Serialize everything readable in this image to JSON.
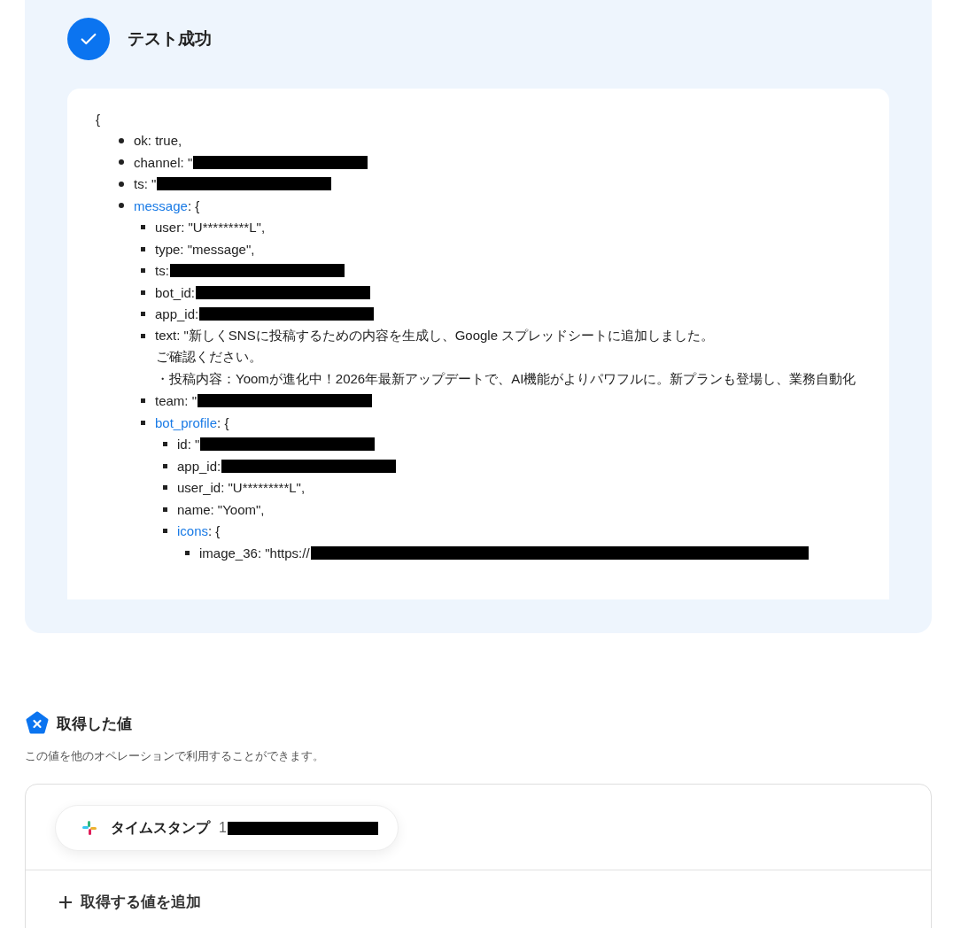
{
  "result": {
    "title": "テスト成功",
    "open_brace": "{",
    "items": [
      {
        "kind": "field",
        "text": "ok: true,"
      },
      {
        "kind": "redacted",
        "text": "channel: \""
      },
      {
        "kind": "redacted",
        "text": "ts: \""
      },
      {
        "kind": "object",
        "key": "message",
        "suffix": ": {",
        "children": [
          {
            "kind": "field",
            "text": "user: \"U*********L\","
          },
          {
            "kind": "field",
            "text": "type: \"message\","
          },
          {
            "kind": "redacted",
            "text": "ts: "
          },
          {
            "kind": "redacted",
            "text": "bot_id: "
          },
          {
            "kind": "redacted",
            "text": "app_id:"
          },
          {
            "kind": "field",
            "text": "text: \"新しくSNSに投稿するための内容を生成し、Google スプレッドシートに追加しました。",
            "more": [
              "ご確認ください。",
              "・投稿内容：Yoomが進化中！2026年最新アップデートで、AI機能がよりパワフルに。新プランも登場し、業務自動化"
            ]
          },
          {
            "kind": "redacted",
            "text": "team: \""
          },
          {
            "kind": "object",
            "key": "bot_profile",
            "suffix": ": {",
            "children": [
              {
                "kind": "redacted",
                "text": "id: \""
              },
              {
                "kind": "redacted",
                "text": "app_id: "
              },
              {
                "kind": "field",
                "text": "user_id: \"U*********L\","
              },
              {
                "kind": "field",
                "text": "name: \"Yoom\","
              },
              {
                "kind": "object",
                "key": "icons",
                "suffix": ": {",
                "children": [
                  {
                    "kind": "redacted_url",
                    "text": "image_36: \"https://"
                  }
                ]
              }
            ]
          }
        ]
      }
    ]
  },
  "values": {
    "title": "取得した値",
    "description": "この値を他のオペレーションで利用することができます。",
    "chips": [
      {
        "kind": "redacted",
        "label": "タイムスタンプ",
        "value": "1"
      }
    ],
    "add_button": "取得する値を追加"
  }
}
